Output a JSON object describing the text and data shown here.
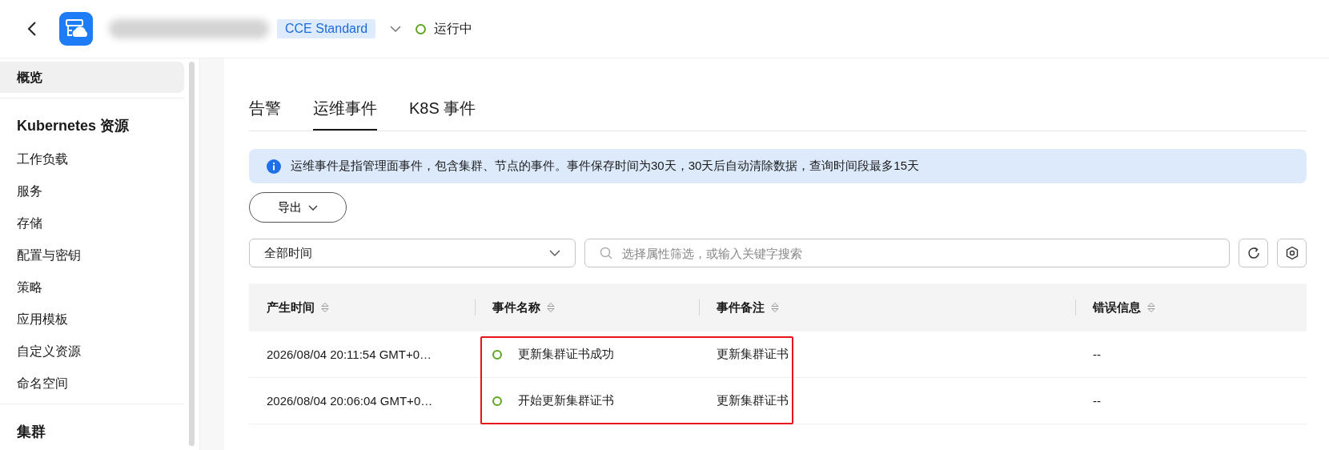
{
  "header": {
    "cluster_type": "CCE Standard",
    "status": {
      "label": "运行中"
    }
  },
  "sidebar": {
    "items": [
      {
        "kind": "link",
        "label": "概览",
        "selected": true
      },
      {
        "kind": "heading",
        "label": "Kubernetes 资源"
      },
      {
        "kind": "link",
        "label": "工作负载",
        "selected": false
      },
      {
        "kind": "link",
        "label": "服务",
        "selected": false
      },
      {
        "kind": "link",
        "label": "存储",
        "selected": false
      },
      {
        "kind": "link",
        "label": "配置与密钥",
        "selected": false
      },
      {
        "kind": "link",
        "label": "策略",
        "selected": false
      },
      {
        "kind": "link",
        "label": "应用模板",
        "selected": false
      },
      {
        "kind": "link",
        "label": "自定义资源",
        "selected": false
      },
      {
        "kind": "link",
        "label": "命名空间",
        "selected": false
      },
      {
        "kind": "heading",
        "label": "集群"
      }
    ]
  },
  "tabs": [
    {
      "label": "告警",
      "selected": false
    },
    {
      "label": "运维事件",
      "selected": true
    },
    {
      "label": "K8S 事件",
      "selected": false
    }
  ],
  "notice": "运维事件是指管理面事件，包含集群、节点的事件。事件保存时间为30天，30天后自动清除数据，查询时间段最多15天",
  "export_button": "导出",
  "time_filter": {
    "value": "全部时间"
  },
  "search": {
    "placeholder": "选择属性筛选，或输入关键字搜索"
  },
  "table": {
    "columns": [
      "产生时间",
      "事件名称",
      "事件备注",
      "错误信息"
    ],
    "rows": [
      {
        "time": "2026/08/04 20:11:54 GMT+0…",
        "name": "更新集群证书成功",
        "remark": "更新集群证书",
        "error": "--"
      },
      {
        "time": "2026/08/04 20:06:04 GMT+0…",
        "name": "开始更新集群证书",
        "remark": "更新集群证书",
        "error": "--"
      }
    ]
  }
}
